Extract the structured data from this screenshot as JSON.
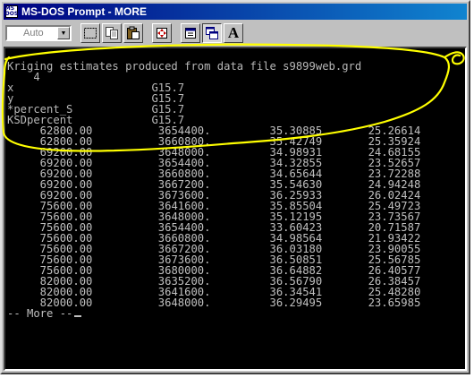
{
  "window": {
    "title": "MS-DOS Prompt - MORE",
    "icon_text": [
      "MS",
      "DOS"
    ]
  },
  "toolbar": {
    "font_value": "Auto",
    "buttons": [
      "mark-icon",
      "copy-icon",
      "paste-icon",
      "fullscreen-icon",
      "properties-icon",
      "background-icon",
      "font-icon"
    ],
    "font_button_label": "A"
  },
  "console": {
    "header": "Kriging estimates produced from data file s9899web.grd",
    "count": "    4",
    "fields": [
      {
        "name": "x",
        "format": "G15.7"
      },
      {
        "name": "y",
        "format": "G15.7"
      },
      {
        "name": "*percent_S",
        "format": "G15.7"
      },
      {
        "name": "KSDpercent",
        "format": "G15.7"
      }
    ],
    "rows": [
      [
        "62800.00",
        "3654400.",
        "35.30885",
        "25.26614"
      ],
      [
        "62800.00",
        "3660800.",
        "35.42749",
        "25.35924"
      ],
      [
        "69200.00",
        "3648000.",
        "34.98931",
        "24.68155"
      ],
      [
        "69200.00",
        "3654400.",
        "34.32855",
        "23.52657"
      ],
      [
        "69200.00",
        "3660800.",
        "34.65644",
        "23.72288"
      ],
      [
        "69200.00",
        "3667200.",
        "35.54630",
        "24.94248"
      ],
      [
        "69200.00",
        "3673600.",
        "36.25933",
        "26.02424"
      ],
      [
        "75600.00",
        "3641600.",
        "35.85504",
        "25.49723"
      ],
      [
        "75600.00",
        "3648000.",
        "35.12195",
        "23.73567"
      ],
      [
        "75600.00",
        "3654400.",
        "33.60423",
        "20.71587"
      ],
      [
        "75600.00",
        "3660800.",
        "34.98564",
        "21.93422"
      ],
      [
        "75600.00",
        "3667200.",
        "36.03180",
        "23.90055"
      ],
      [
        "75600.00",
        "3673600.",
        "36.50851",
        "25.56785"
      ],
      [
        "75600.00",
        "3680000.",
        "36.64882",
        "26.40577"
      ],
      [
        "82000.00",
        "3635200.",
        "36.56790",
        "26.38457"
      ],
      [
        "82000.00",
        "3641600.",
        "36.34541",
        "25.48280"
      ],
      [
        "82000.00",
        "3648000.",
        "36.29495",
        "23.65985"
      ]
    ],
    "more_prompt": "-- More --"
  },
  "annotation": {
    "color": "#ffff00"
  }
}
